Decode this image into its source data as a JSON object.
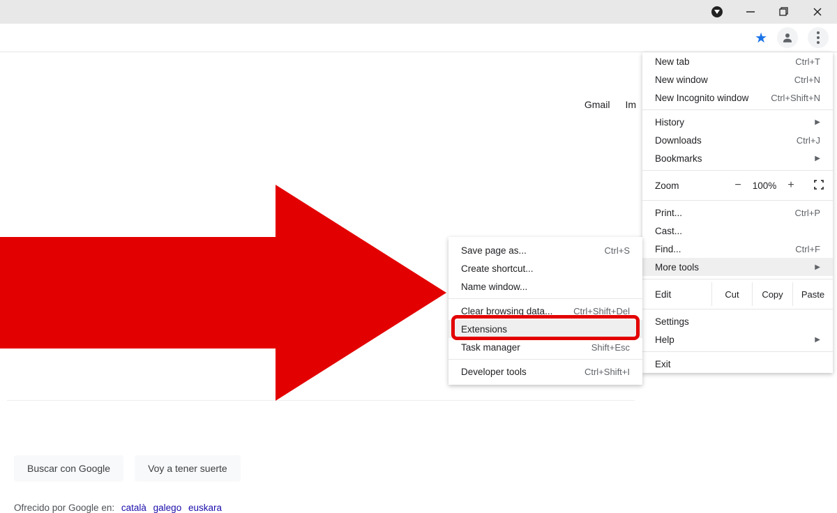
{
  "titlebar": {
    "dropdown_icon": "dropdown-icon",
    "minimize_icon": "minimize-icon",
    "maximize_icon": "maximize-icon",
    "close_icon": "close-icon"
  },
  "toolbar": {
    "star_icon": "bookmark-star-icon",
    "profile_icon": "profile-icon",
    "menu_icon": "kebab-menu-icon"
  },
  "top_links": {
    "gmail": "Gmail",
    "images_partial": "Im"
  },
  "search": {
    "btn1": "Buscar con Google",
    "btn2": "Voy a tener suerte",
    "lang_prefix": "Ofrecido por Google en:",
    "langs": [
      "català",
      "galego",
      "euskara"
    ]
  },
  "menu": {
    "new_tab": "New tab",
    "new_tab_sc": "Ctrl+T",
    "new_window": "New window",
    "new_window_sc": "Ctrl+N",
    "new_incognito": "New Incognito window",
    "new_incognito_sc": "Ctrl+Shift+N",
    "history": "History",
    "downloads": "Downloads",
    "downloads_sc": "Ctrl+J",
    "bookmarks": "Bookmarks",
    "zoom_label": "Zoom",
    "zoom_value": "100%",
    "print": "Print...",
    "print_sc": "Ctrl+P",
    "cast": "Cast...",
    "find": "Find...",
    "find_sc": "Ctrl+F",
    "more_tools": "More tools",
    "edit": "Edit",
    "cut": "Cut",
    "copy": "Copy",
    "paste": "Paste",
    "settings": "Settings",
    "help": "Help",
    "exit": "Exit"
  },
  "submenu": {
    "save_page": "Save page as...",
    "save_page_sc": "Ctrl+S",
    "create_shortcut": "Create shortcut...",
    "name_window": "Name window...",
    "clear_data": "Clear browsing data...",
    "clear_data_sc": "Ctrl+Shift+Del",
    "extensions": "Extensions",
    "task_manager": "Task manager",
    "task_manager_sc": "Shift+Esc",
    "dev_tools": "Developer tools",
    "dev_tools_sc": "Ctrl+Shift+I"
  }
}
